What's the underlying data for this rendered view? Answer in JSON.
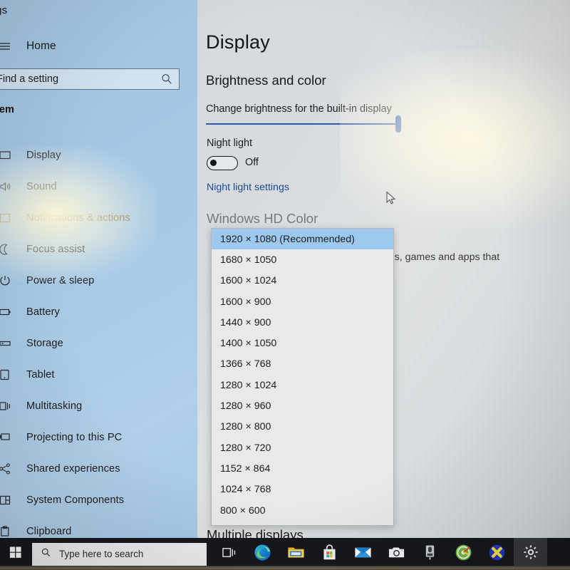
{
  "window": {
    "title": "tings",
    "full_title_hint": "Settings"
  },
  "sidebar": {
    "home_label": "Home",
    "home_icon": "hamburger-icon",
    "search": {
      "placeholder": "Find a setting",
      "icon": "search-icon"
    },
    "group_title": "stem",
    "items": [
      {
        "label": "Display",
        "icon": "monitor-icon"
      },
      {
        "label": "Sound",
        "icon": "speaker-icon"
      },
      {
        "label": "Notifications & actions",
        "icon": "notification-icon"
      },
      {
        "label": "Focus assist",
        "icon": "moon-icon"
      },
      {
        "label": "Power & sleep",
        "icon": "power-icon"
      },
      {
        "label": "Battery",
        "icon": "battery-icon"
      },
      {
        "label": "Storage",
        "icon": "storage-icon"
      },
      {
        "label": "Tablet",
        "icon": "tablet-icon"
      },
      {
        "label": "Multitasking",
        "icon": "multitasking-icon"
      },
      {
        "label": "Projecting to this PC",
        "icon": "projector-icon"
      },
      {
        "label": "Shared experiences",
        "icon": "share-icon"
      },
      {
        "label": "System Components",
        "icon": "components-icon"
      },
      {
        "label": "Clipboard",
        "icon": "clipboard-icon"
      }
    ]
  },
  "main": {
    "page_title": "Display",
    "brightness_section": {
      "heading": "Brightness and color",
      "slider_label": "Change brightness for the built-in display",
      "slider_value": 100
    },
    "night_light": {
      "label": "Night light",
      "toggle_state": "Off",
      "settings_link": "Night light settings"
    },
    "hdr_section": {
      "heading": "Windows HD Color",
      "description_visible_fragment": "deos, games and apps that"
    },
    "multiple_displays_heading": "Multiple displays"
  },
  "resolution_dropdown": {
    "open": true,
    "selected_index": 0,
    "options": [
      "1920 × 1080 (Recommended)",
      "1680 × 1050",
      "1600 × 1024",
      "1600 × 900",
      "1440 × 900",
      "1400 × 1050",
      "1366 × 768",
      "1280 × 1024",
      "1280 × 960",
      "1280 × 800",
      "1280 × 720",
      "1152 × 864",
      "1024 × 768",
      "800 × 600"
    ]
  },
  "taskbar": {
    "start_icon": "windows-logo-icon",
    "search_placeholder": "Type here to search",
    "search_icon": "search-icon",
    "icons": [
      {
        "name": "task-view-icon",
        "active": false,
        "running": false
      },
      {
        "name": "microsoft-edge-icon",
        "active": false,
        "running": false
      },
      {
        "name": "file-explorer-icon",
        "active": false,
        "running": false
      },
      {
        "name": "microsoft-store-icon",
        "active": false,
        "running": false
      },
      {
        "name": "mail-icon",
        "active": false,
        "running": false
      },
      {
        "name": "camera-icon",
        "active": false,
        "running": false
      },
      {
        "name": "voice-recorder-icon",
        "active": false,
        "running": false
      },
      {
        "name": "media-disc-icon",
        "active": false,
        "running": false
      },
      {
        "name": "x-badge-icon",
        "active": false,
        "running": true
      },
      {
        "name": "settings-gear-icon",
        "active": true,
        "running": true
      }
    ]
  },
  "colors": {
    "accent": "#2f58b4",
    "selection": "#9dc8ef",
    "link": "#1d4b8f",
    "sidebar": "#a9c9e4",
    "content": "#dcdfe1",
    "taskbar": "#16181d"
  }
}
